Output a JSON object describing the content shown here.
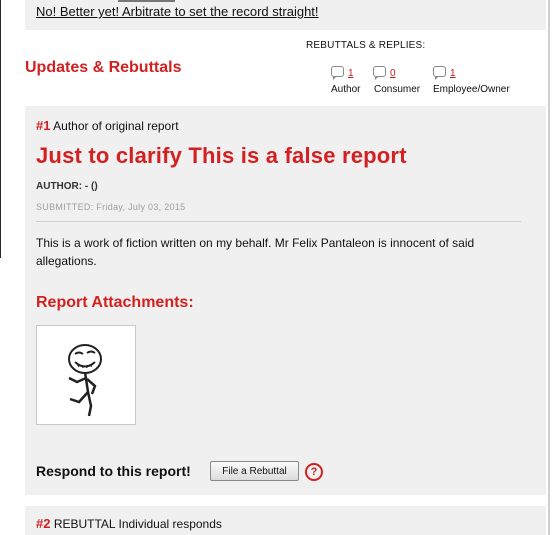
{
  "top": {
    "arbitrate_link": "No! Better yet! Arbitrate to set the record straight!"
  },
  "header": {
    "rebuttals_title": "REBUTTALS & REPLIES:",
    "section_title": "Updates & Rebuttals",
    "counts": [
      {
        "value": "1",
        "label": "Author"
      },
      {
        "value": "0",
        "label": "Consumer"
      },
      {
        "value": "1",
        "label": "Employee/Owner"
      }
    ]
  },
  "report": {
    "number": "#1",
    "role": "Author of original report",
    "title": "Just to clarify This is a false report",
    "author": "AUTHOR: - ()",
    "submitted": "SUBMITTED: Friday, July 03, 2015",
    "body": "This is a work of fiction written on  my behalf. Mr Felix Pantaleon is innocent of said allegations.",
    "attachments_title": "Report Attachments:",
    "respond_text": "Respond to this report!",
    "rebuttal_button": "File a Rebuttal",
    "help_glyph": "?"
  },
  "next_report": {
    "number": "#2",
    "role": "REBUTTAL Individual responds"
  },
  "colors": {
    "accent": "#d32020",
    "panel": "#f0f0f0",
    "muted": "#a0a0a0"
  },
  "icons": {
    "reply": "speech-bubble-icon",
    "help": "help-circle-icon",
    "attachment": "stick-figure-image"
  }
}
